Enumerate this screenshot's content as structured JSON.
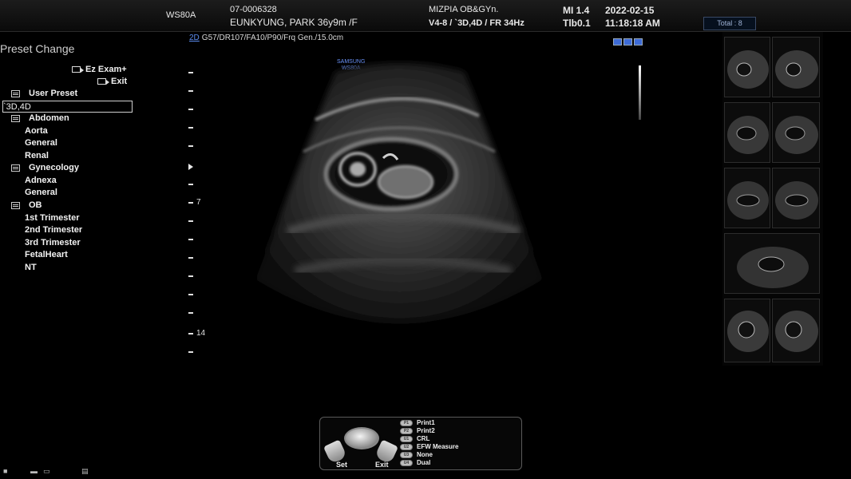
{
  "header": {
    "system": "WS80A",
    "patient_id": "07-0006328",
    "patient_name": "EUNKYUNG, PARK 36y9m /F",
    "institution": "MIZPIA OB&GYn.",
    "probe_info": "V4-8 / `3D,4D / FR 34Hz",
    "mi": "MI  1.4",
    "tib": "Tlb0.1",
    "date": "2022-02-15",
    "time": "11:18:18 AM",
    "total": "Total : 8"
  },
  "preset_panel": {
    "title": "Preset Change",
    "ez_exam": "Ez Exam+",
    "exit": "Exit",
    "tree": [
      {
        "label": "User Preset",
        "type": "group"
      },
      {
        "label": "`3D,4D",
        "type": "selected"
      },
      {
        "label": "Abdomen",
        "type": "group"
      },
      {
        "label": "Aorta",
        "type": "item"
      },
      {
        "label": "General",
        "type": "item"
      },
      {
        "label": "Renal",
        "type": "item"
      },
      {
        "label": "Gynecology",
        "type": "group"
      },
      {
        "label": "Adnexa",
        "type": "item"
      },
      {
        "label": "General",
        "type": "item"
      },
      {
        "label": "OB",
        "type": "group"
      },
      {
        "label": "1st Trimester",
        "type": "item"
      },
      {
        "label": "2nd Trimester",
        "type": "item"
      },
      {
        "label": "3rd Trimester",
        "type": "item"
      },
      {
        "label": "FetalHeart",
        "type": "item"
      },
      {
        "label": "NT",
        "type": "item"
      }
    ]
  },
  "image_params": {
    "mode": "2D",
    "settings": "G57/DR107/FA10/P90/Frq Gen./15.0cm"
  },
  "probe_mark": {
    "line1": "SAMSUNG",
    "line2": "WS80A"
  },
  "depth_scale": {
    "labels": [
      "7",
      "14"
    ]
  },
  "control_panel": {
    "set_label": "Set",
    "exit_label": "Exit",
    "fkeys": [
      {
        "key": "P1",
        "label": "Print1"
      },
      {
        "key": "P2",
        "label": "Print2"
      },
      {
        "key": "U1",
        "label": "CRL"
      },
      {
        "key": "U2",
        "label": "EFW Measure"
      },
      {
        "key": "U3",
        "label": "None"
      },
      {
        "key": "U4",
        "label": "Dual"
      }
    ]
  },
  "colors": {
    "accent_blue": "#5b8cf0",
    "background": "#000000",
    "text": "#e6e6e6"
  },
  "icons": [
    "lock-icon",
    "probe-icon",
    "network-icon"
  ]
}
